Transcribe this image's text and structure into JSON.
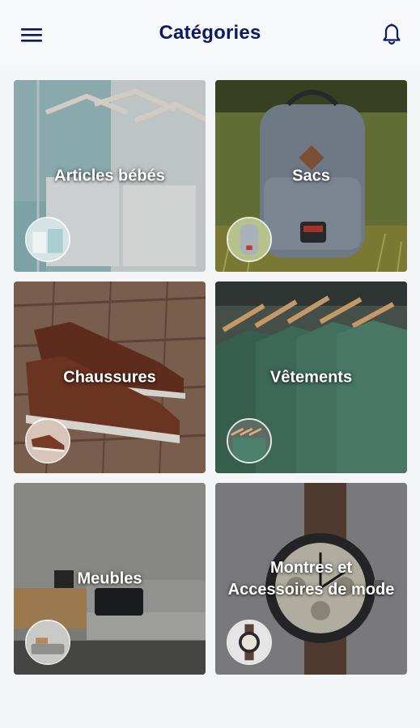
{
  "header": {
    "title": "Catégories",
    "menu_icon": "hamburger-menu-icon",
    "notification_icon": "bell-icon"
  },
  "categories": [
    {
      "label": "Articles bébés",
      "image": "baby-clothes-on-hangers"
    },
    {
      "label": "Sacs",
      "image": "grey-backpack-on-grass"
    },
    {
      "label": "Chaussures",
      "image": "brown-sneakers-on-bricks"
    },
    {
      "label": "Vêtements",
      "image": "green-tshirts-on-hangers"
    },
    {
      "label": "Meubles",
      "image": "grey-sofa-living-room"
    },
    {
      "label": "Montres et\nAccessoires de mode",
      "image": "wrist-watch"
    }
  ],
  "colors": {
    "title": "#0d1a5e",
    "app_bar_bg": "#f7f8f9",
    "content_bg": "#f4f5f6",
    "label_text": "#ffffff"
  }
}
